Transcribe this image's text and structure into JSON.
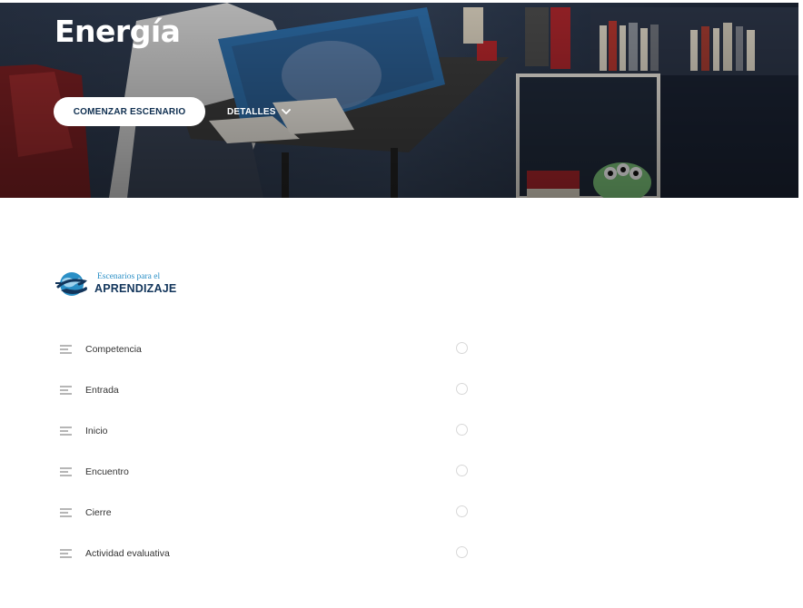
{
  "hero": {
    "title": "Energía",
    "start_button": "COMENZAR ESCENARIO",
    "details_button": "DETALLES"
  },
  "logo": {
    "line1": "Escenarios para el",
    "line2": "APRENDIZAJE"
  },
  "sections": [
    {
      "label": "Competencia"
    },
    {
      "label": "Entrada"
    },
    {
      "label": "Inicio"
    },
    {
      "label": "Encuentro"
    },
    {
      "label": "Cierre"
    },
    {
      "label": "Actividad evaluativa"
    }
  ],
  "colors": {
    "hero_overlay": "#1e2a3c",
    "brand_dark": "#12355b",
    "brand_light": "#2a8fc6",
    "text": "#333333",
    "icon": "#8a8a8a"
  }
}
